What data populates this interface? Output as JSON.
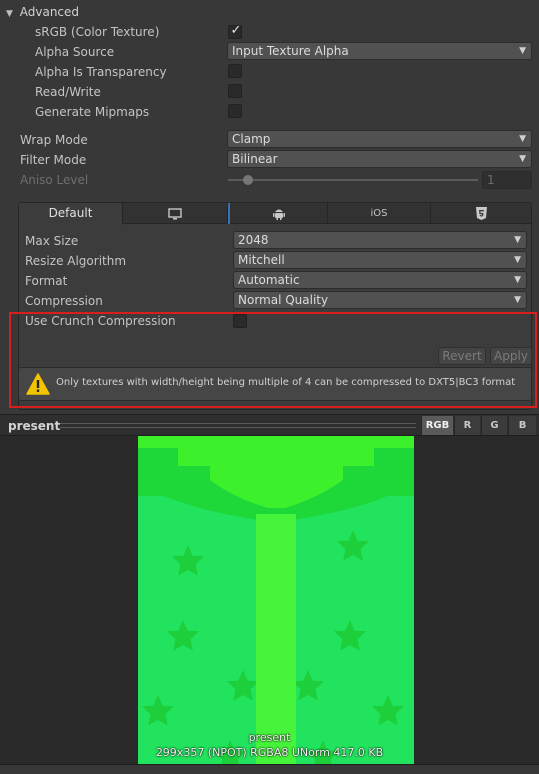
{
  "advanced": {
    "title": "Advanced",
    "srgb_label": "sRGB (Color Texture)",
    "srgb_checked": true,
    "alpha_source_label": "Alpha Source",
    "alpha_source_value": "Input Texture Alpha",
    "alpha_transparency_label": "Alpha Is Transparency",
    "read_write_label": "Read/Write",
    "generate_mipmaps_label": "Generate Mipmaps"
  },
  "sampling": {
    "wrap_mode_label": "Wrap Mode",
    "wrap_mode_value": "Clamp",
    "filter_mode_label": "Filter Mode",
    "filter_mode_value": "Bilinear",
    "aniso_label": "Aniso Level",
    "aniso_value": "1"
  },
  "platform": {
    "tabs": [
      {
        "label": "Default",
        "icon": "none"
      },
      {
        "label": "",
        "icon": "monitor-icon"
      },
      {
        "label": "",
        "icon": "android-icon"
      },
      {
        "label": "iOS",
        "icon": "none"
      },
      {
        "label": "",
        "icon": "html5-icon"
      }
    ],
    "max_size_label": "Max Size",
    "max_size_value": "2048",
    "resize_label": "Resize Algorithm",
    "resize_value": "Mitchell",
    "format_label": "Format",
    "format_value": "Automatic",
    "compression_label": "Compression",
    "compression_value": "Normal Quality",
    "crunch_label": "Use Crunch Compression",
    "revert_label": "Revert",
    "apply_label": "Apply",
    "warning_text": "Only textures with width/height being multiple of 4 can be compressed to DXT5|BC3 format"
  },
  "preview": {
    "title": "present",
    "channels": [
      "RGB",
      "R",
      "G",
      "B"
    ],
    "active_channel": "RGB",
    "caption_name": "present",
    "caption_info": "299x357 (NPOT)  RGBA8 UNorm  417.0 KB"
  },
  "colors": {
    "highlight": "#d81e1e",
    "warning": "#f2c300",
    "texture_dark": "#1ed83a",
    "texture_light": "#4dff2e",
    "texture_base": "#22e35d"
  }
}
